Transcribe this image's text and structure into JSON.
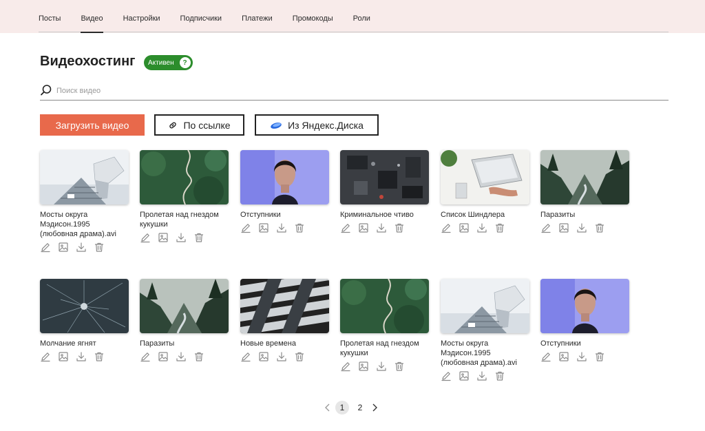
{
  "nav": {
    "tabs": [
      {
        "label": "Посты",
        "active": false
      },
      {
        "label": "Видео",
        "active": true
      },
      {
        "label": "Настройки",
        "active": false
      },
      {
        "label": "Подписчики",
        "active": false
      },
      {
        "label": "Платежи",
        "active": false
      },
      {
        "label": "Промокоды",
        "active": false
      },
      {
        "label": "Роли",
        "active": false
      }
    ]
  },
  "page": {
    "title": "Видеохостинг",
    "status_badge": "Активен",
    "status_help": "?"
  },
  "search": {
    "placeholder": "Поиск видео",
    "value": ""
  },
  "toolbar": {
    "upload_label": "Загрузить видео",
    "by_link_label": "По ссылке",
    "yandex_disk_label": "Из Яндекс.Диска"
  },
  "videos": [
    {
      "title": "Мосты округа Мэдисон.1995 (любовная драма).avi",
      "thumb": "building"
    },
    {
      "title": "Пролетая над гнездом кукушки",
      "thumb": "road"
    },
    {
      "title": "Отступники",
      "thumb": "portrait"
    },
    {
      "title": "Криминальное чтиво",
      "thumb": "circuit"
    },
    {
      "title": "Список Шиндлера",
      "thumb": "desk"
    },
    {
      "title": "Паразиты",
      "thumb": "forest"
    },
    {
      "title": "Молчание ягнят",
      "thumb": "stars"
    },
    {
      "title": "Паразиты",
      "thumb": "forest"
    },
    {
      "title": "Новые времена",
      "thumb": "architecture"
    },
    {
      "title": "Пролетая над гнездом кукушки",
      "thumb": "road"
    },
    {
      "title": "Мосты округа Мэдисон.1995 (любовная драма).avi",
      "thumb": "building"
    },
    {
      "title": "Отступники",
      "thumb": "portrait"
    }
  ],
  "pagination": {
    "pages": [
      "1",
      "2"
    ],
    "current": "1"
  },
  "colors": {
    "topbar_bg": "#f8ebea",
    "accent": "#e8694b",
    "status_green": "#2c8d2c",
    "yandex_blue": "#2a6be0"
  }
}
